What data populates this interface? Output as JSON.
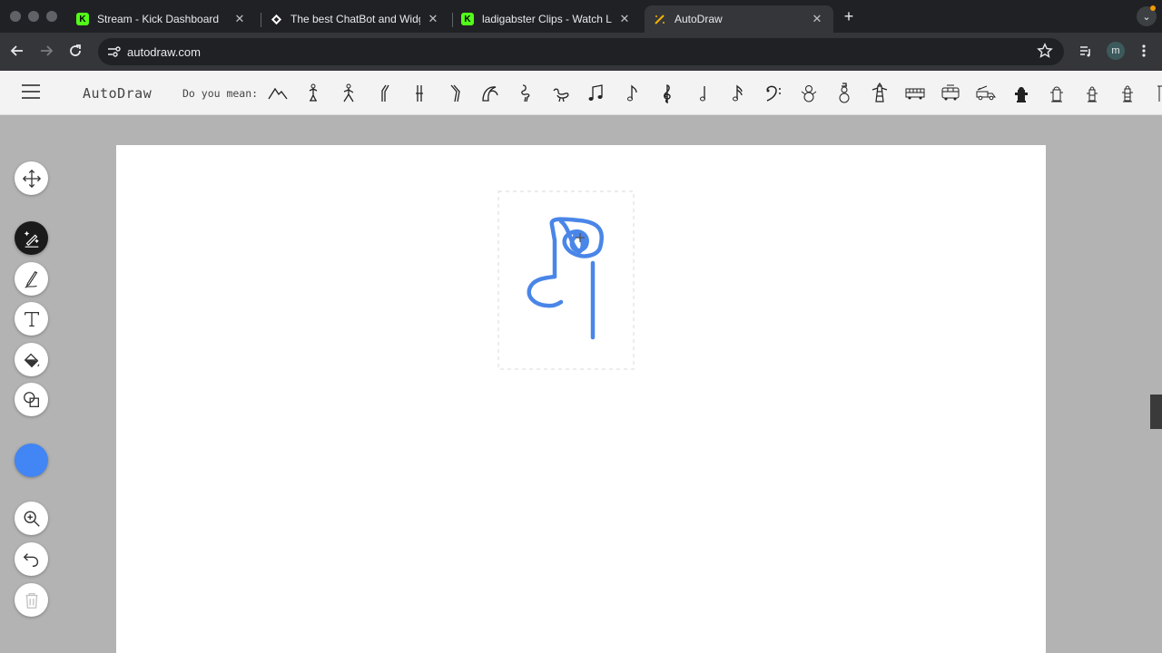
{
  "browser": {
    "tabs": [
      {
        "title": "Stream - Kick Dashboard",
        "favicon": "kick-icon",
        "active": false
      },
      {
        "title": "The best ChatBot and Widgets",
        "favicon": "diamond-icon",
        "active": false
      },
      {
        "title": "ladigabster Clips - Watch Live",
        "favicon": "kick-icon",
        "active": false
      },
      {
        "title": "AutoDraw",
        "favicon": "autodraw-icon",
        "active": true
      }
    ],
    "url": "autodraw.com",
    "profile_initial": "m"
  },
  "app": {
    "brand": "AutoDraw",
    "suggestions_label": "Do you mean:",
    "suggestions": [
      "mountain-icon",
      "yoga-pose-icon",
      "person-walking-icon",
      "bent-leg-icon",
      "leg-icon",
      "knee-icon",
      "crescent-icon",
      "flamingo-icon",
      "bird-icon",
      "beamed-notes-icon",
      "eighth-note-icon",
      "treble-clef-icon",
      "quarter-note-icon",
      "sixteenth-note-icon",
      "bass-clef-icon",
      "snowman-icon",
      "snowman-hat-icon",
      "lighthouse-icon",
      "bus-icon",
      "tram-icon",
      "fire-truck-icon",
      "fire-hydrant-icon",
      "hydrant-icon",
      "hydrant-icon",
      "hydrant-icon",
      "pole-icon"
    ]
  },
  "tools": [
    {
      "name": "select-tool",
      "icon": "move-icon",
      "active": false
    },
    {
      "name": "autodraw-tool",
      "icon": "autodraw-sparkle-icon",
      "active": true
    },
    {
      "name": "draw-tool",
      "icon": "pen-icon",
      "active": false
    },
    {
      "name": "type-tool",
      "icon": "text-icon",
      "active": false
    },
    {
      "name": "fill-tool",
      "icon": "paint-bucket-icon",
      "active": false
    },
    {
      "name": "shape-tool",
      "icon": "shapes-icon",
      "active": false
    },
    {
      "name": "zoom-tool",
      "icon": "zoom-icon",
      "active": false
    },
    {
      "name": "undo-tool",
      "icon": "undo-icon",
      "active": false
    },
    {
      "name": "delete-tool",
      "icon": "trash-icon",
      "active": false
    }
  ],
  "colors": {
    "stroke": "#4a86e8",
    "selected_color": "#4285f4",
    "chrome_dark": "#202124",
    "header_bg": "#f3f3f3",
    "workspace_bg": "#b3b3b3"
  }
}
